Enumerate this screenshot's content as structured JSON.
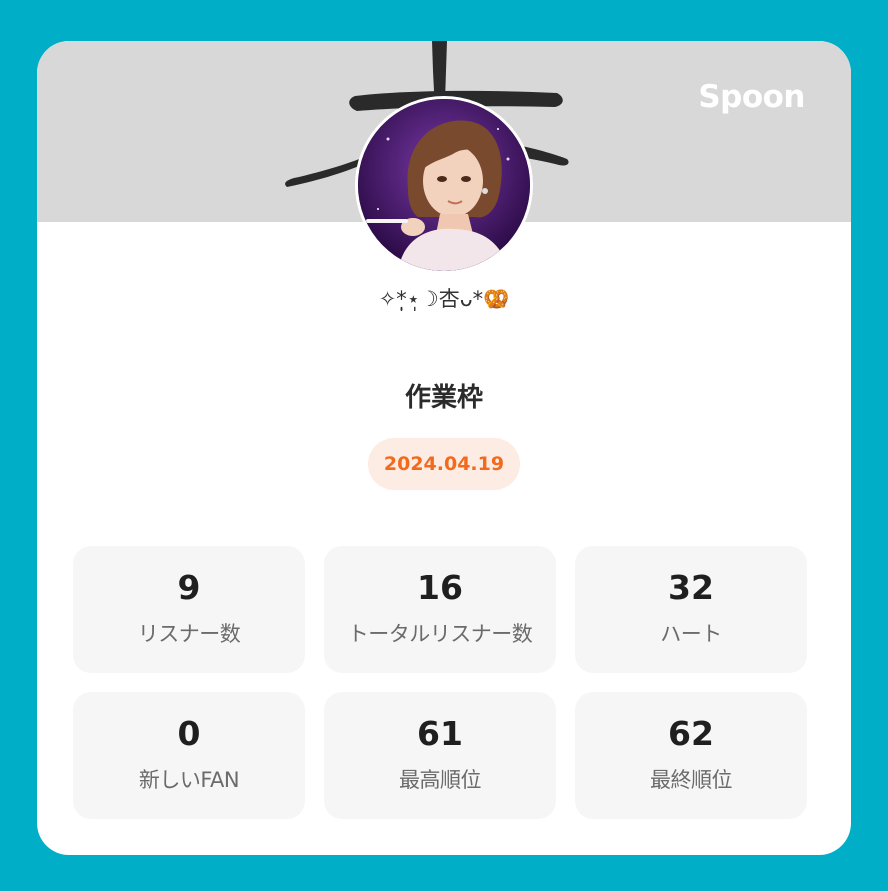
{
  "brand": {
    "name": "Spoon"
  },
  "profile": {
    "username_prefix": "✧*̣̩⋆̩☽杏ᴗ*",
    "username_emoji": "🥨",
    "broadcast_title": "作業枠",
    "date": "2024.04.19"
  },
  "stats": [
    {
      "value": "9",
      "label": "リスナー数"
    },
    {
      "value": "16",
      "label": "トータルリスナー数"
    },
    {
      "value": "32",
      "label": "ハート"
    },
    {
      "value": "0",
      "label": "新しいFAN"
    },
    {
      "value": "61",
      "label": "最高順位"
    },
    {
      "value": "62",
      "label": "最終順位"
    }
  ],
  "colors": {
    "background": "#00aec7",
    "card": "#ffffff",
    "banner": "#d8d8d8",
    "date_text": "#f26b1d",
    "date_badge": "#fdece3",
    "stat_tile": "#f6f6f6"
  }
}
